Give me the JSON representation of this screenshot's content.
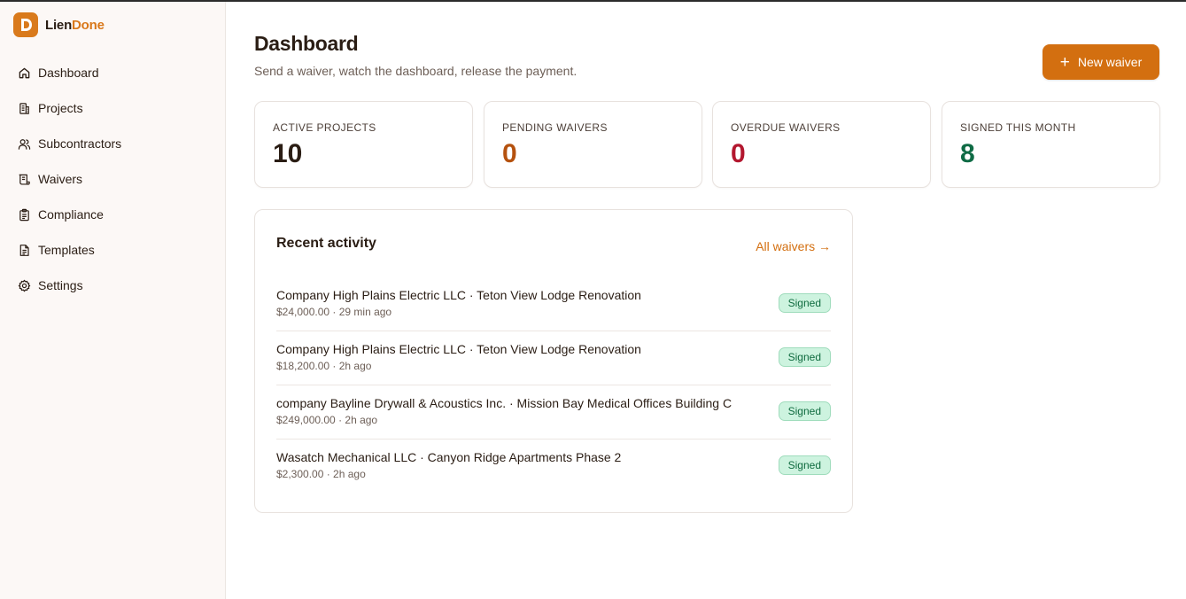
{
  "brand": {
    "name_part1": "Lien",
    "name_part2": "Done",
    "color": "#d97a1c"
  },
  "sidebar": {
    "items": [
      {
        "label": "Dashboard",
        "icon": "home-icon"
      },
      {
        "label": "Projects",
        "icon": "building-icon"
      },
      {
        "label": "Subcontractors",
        "icon": "users-icon"
      },
      {
        "label": "Waivers",
        "icon": "scroll-icon"
      },
      {
        "label": "Compliance",
        "icon": "clipboard-icon"
      },
      {
        "label": "Templates",
        "icon": "document-icon"
      },
      {
        "label": "Settings",
        "icon": "gear-icon"
      }
    ]
  },
  "header": {
    "title": "Dashboard",
    "subtitle": "Send a waiver, watch the dashboard, release the payment.",
    "new_button_label": "New waiver"
  },
  "stats": [
    {
      "label": "ACTIVE PROJECTS",
      "value": "10",
      "color": "#2a1d14"
    },
    {
      "label": "PENDING WAIVERS",
      "value": "0",
      "color": "#b5520f"
    },
    {
      "label": "OVERDUE WAIVERS",
      "value": "0",
      "color": "#b3172f"
    },
    {
      "label": "SIGNED THIS MONTH",
      "value": "8",
      "color": "#0f6b45"
    }
  ],
  "activity": {
    "title": "Recent activity",
    "link_label": "All waivers →",
    "rows": [
      {
        "main": "Company High Plains Electric LLC · Teton View Lodge Renovation",
        "meta": "$24,000.00 · 29 min ago",
        "status": "Signed"
      },
      {
        "main": "Company High Plains Electric LLC · Teton View Lodge Renovation",
        "meta": "$18,200.00 · 2h ago",
        "status": "Signed"
      },
      {
        "main": "company Bayline Drywall & Acoustics Inc. · Mission Bay Medical Offices Building C",
        "meta": "$249,000.00 · 2h ago",
        "status": "Signed"
      },
      {
        "main": "Wasatch Mechanical LLC · Canyon Ridge Apartments Phase 2",
        "meta": "$2,300.00 · 2h ago",
        "status": "Signed"
      }
    ]
  },
  "colors": {
    "accent": "#d36f10",
    "signed_bg": "#cdf3df",
    "signed_text": "#0f6b3f"
  }
}
